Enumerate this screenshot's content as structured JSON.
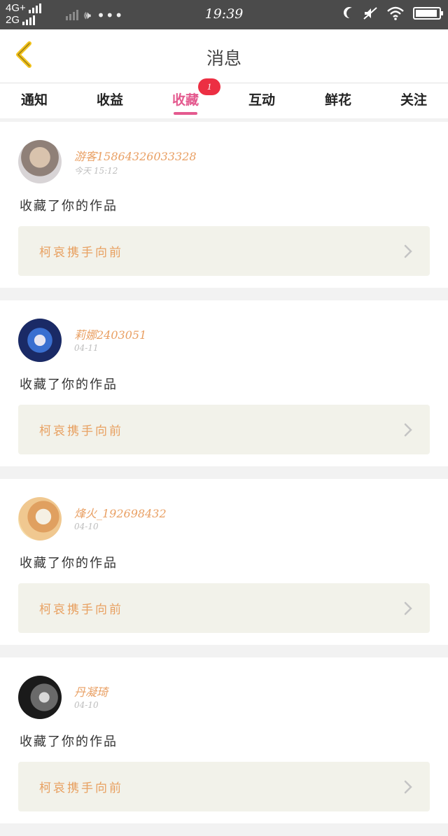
{
  "status_bar": {
    "network_top": "4G+",
    "network_bottom": "2G",
    "dots": "•••",
    "time": "19:39",
    "battery_level": 0.95
  },
  "nav": {
    "title": "消息",
    "back_icon": "chevron-left-icon",
    "accent_color": "#f2c21b"
  },
  "tabs": {
    "items": [
      {
        "label": "通知"
      },
      {
        "label": "收益"
      },
      {
        "label": "收藏"
      },
      {
        "label": "互动"
      },
      {
        "label": "鲜花"
      },
      {
        "label": "关注"
      }
    ],
    "active_index": 2,
    "active_color": "#e45a8f",
    "badge": "1"
  },
  "messages": [
    {
      "username": "游客15864326033328",
      "time": "今天 15:12",
      "action": "收藏了你的作品",
      "work_title": "柯哀携手向前"
    },
    {
      "username": "莉娜2403051",
      "time": "04-11",
      "action": "收藏了你的作品",
      "work_title": "柯哀携手向前"
    },
    {
      "username": "烽火_192698432",
      "time": "04-10",
      "action": "收藏了你的作品",
      "work_title": "柯哀携手向前"
    },
    {
      "username": "丹凝琦",
      "time": "04-10",
      "action": "收藏了你的作品",
      "work_title": "柯哀携手向前"
    }
  ]
}
